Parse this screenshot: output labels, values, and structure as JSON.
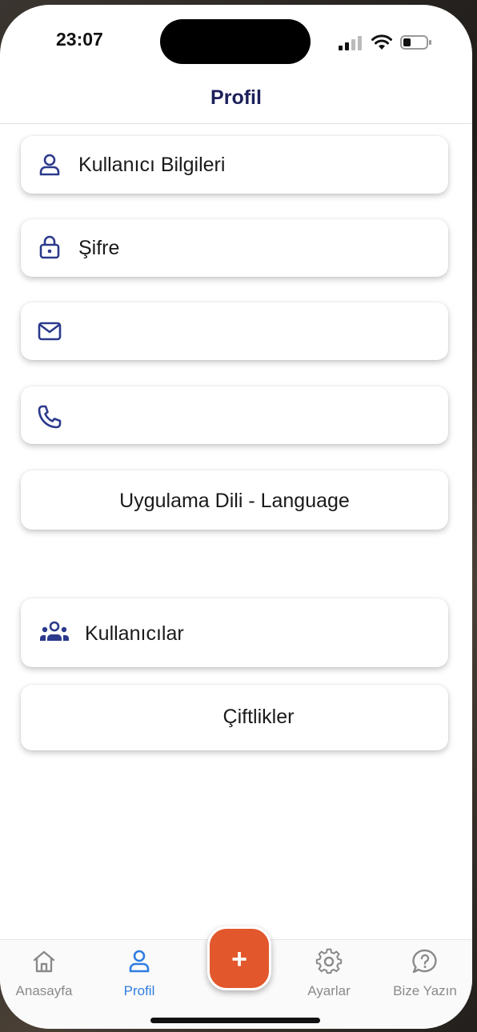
{
  "status_bar": {
    "time": "23:07"
  },
  "header": {
    "title": "Profil"
  },
  "menu": {
    "user_info": {
      "label": "Kullanıcı Bilgileri",
      "icon": "user-icon"
    },
    "password": {
      "label": "Şifre",
      "icon": "lock-icon"
    },
    "email": {
      "label": "",
      "icon": "mail-icon"
    },
    "phone": {
      "label": "",
      "icon": "phone-icon"
    },
    "language": {
      "label": "Uygulama Dili - Language"
    },
    "users": {
      "label": "Kullanıcılar",
      "icon": "users-group-icon"
    },
    "farms": {
      "label": "Çiftlikler"
    }
  },
  "tabbar": {
    "home": {
      "label": "Anasayfa",
      "icon": "home-icon"
    },
    "profile": {
      "label": "Profil",
      "icon": "user-icon"
    },
    "add": {
      "label": "+",
      "icon": "plus-icon"
    },
    "settings": {
      "label": "Ayarlar",
      "icon": "gear-icon"
    },
    "contact": {
      "label": "Bize Yazın",
      "icon": "question-bubble-icon"
    }
  },
  "colors": {
    "accent": "#2f7de1",
    "icon_navy": "#2b3a8c",
    "title_navy": "#1c1f5a",
    "fab": "#e2572b"
  }
}
